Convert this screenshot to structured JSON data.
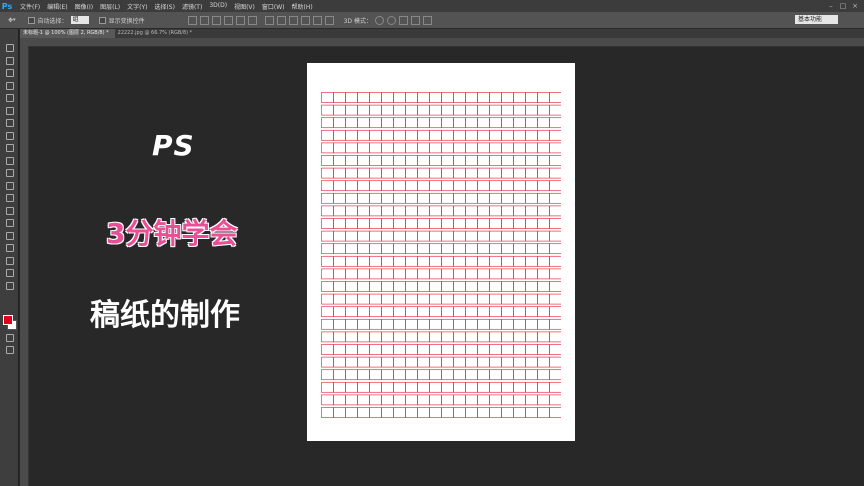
{
  "app": {
    "logo": "Ps"
  },
  "menu": [
    "文件(F)",
    "编辑(E)",
    "图像(I)",
    "图层(L)",
    "文字(Y)",
    "选择(S)",
    "滤镜(T)",
    "3D(D)",
    "视图(V)",
    "窗口(W)",
    "帮助(H)"
  ],
  "options": {
    "auto_select_label": "自动选择：",
    "auto_select_value": "组",
    "show_transform_label": "显示变换控件",
    "mode_label": "3D 模式：",
    "workspace": "基本功能"
  },
  "tabs": [
    {
      "label": "未标题-1 @ 100% (图层 2, RGB/8) *",
      "active": true
    },
    {
      "label": "22222.jpg @ 66.7% (RGB/8) *",
      "active": false
    }
  ],
  "overlay": {
    "ps": "PS",
    "three_min": "3分钟学会",
    "paper": "稿纸的制作"
  },
  "colors": {
    "grid": "#e8344a",
    "foreground": "#e2001a",
    "background": "#ffffff"
  },
  "tools": [
    "move-icon",
    "marquee-icon",
    "lasso-icon",
    "magic-wand-icon",
    "crop-icon",
    "eyedropper-icon",
    "healing-icon",
    "brush-icon",
    "stamp-icon",
    "history-brush-icon",
    "eraser-icon",
    "gradient-icon",
    "blur-icon",
    "dodge-icon",
    "pen-icon",
    "type-icon",
    "path-select-icon",
    "shape-icon",
    "hand-icon",
    "zoom-icon"
  ]
}
